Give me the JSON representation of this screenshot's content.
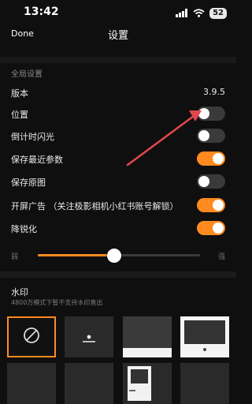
{
  "status_bar": {
    "time": "13:42",
    "battery": "52"
  },
  "nav": {
    "done_label": "Done",
    "title": "设置"
  },
  "sections": {
    "global_title": "全局设置"
  },
  "rows": {
    "version": {
      "label": "版本",
      "value": "3.9.5"
    },
    "location": {
      "label": "位置",
      "toggle_on": false
    },
    "countdown_flash": {
      "label": "倒计时闪光",
      "toggle_on": false
    },
    "save_recent_params": {
      "label": "保存最近参数",
      "toggle_on": true
    },
    "save_original": {
      "label": "保存原图",
      "toggle_on": false
    },
    "splash_ad": {
      "label": "开屏广告 （关注极影相机小红书账号解锁）",
      "toggle_on": true
    },
    "sharpen_reduce": {
      "label": "降锐化",
      "toggle_on": true
    }
  },
  "slider": {
    "min_label": "弱",
    "max_label": "强",
    "value": 0.47
  },
  "watermark": {
    "title": "水印",
    "note": "4800万模式下暂不支持水印直出",
    "options": [
      "no-watermark",
      "dot-label",
      "bottom-bar",
      "white-frame",
      "plain",
      "plain",
      "side-card",
      "plain"
    ]
  },
  "colors": {
    "accent": "#ff8a1f",
    "annotation_arrow": "#e0474c"
  }
}
